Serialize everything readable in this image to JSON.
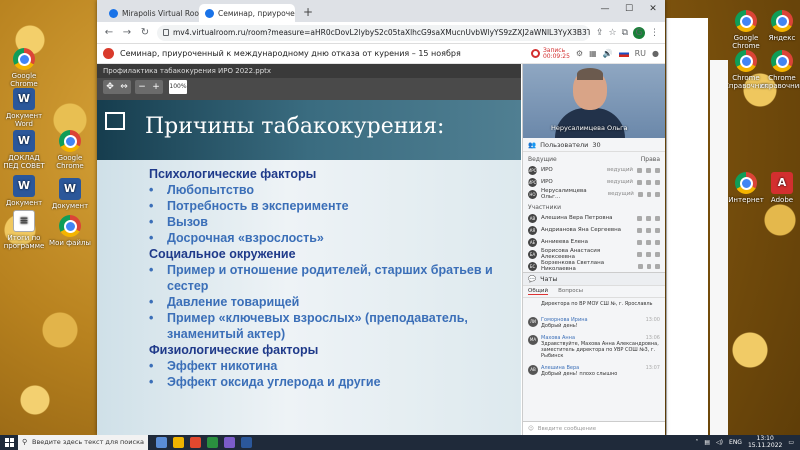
{
  "desktop": {
    "left_icons": [
      {
        "label": "Google Chrome",
        "type": "chrome"
      },
      {
        "label": "Документ Word",
        "type": "word"
      },
      {
        "label": "ДОКЛАД ПЕД СОВЕТ",
        "type": "word"
      },
      {
        "label": "Google Chrome",
        "type": "chrome"
      },
      {
        "label": "Документ",
        "type": "word"
      },
      {
        "label": "Итоги по программе",
        "type": "doc"
      },
      {
        "label": "Документ",
        "type": "word"
      },
      {
        "label": "Мои файлы",
        "type": "chrome"
      }
    ],
    "right_icons": [
      {
        "label": "Google Chrome",
        "type": "chrome"
      },
      {
        "label": "Яндекс",
        "type": "chrome"
      },
      {
        "label": "Chrome Справочник",
        "type": "chrome"
      },
      {
        "label": "Chrome справочник",
        "type": "chrome"
      },
      {
        "label": "Adobe",
        "type": "pdf"
      },
      {
        "label": "Интернет",
        "type": "chrome"
      }
    ]
  },
  "browser": {
    "tabs": [
      {
        "title": "Mirapolis Virtual Room",
        "active": false
      },
      {
        "title": "Семинар, приуроченный к",
        "active": true
      }
    ],
    "new_tab": "+",
    "url": "mv4.virtualroom.ru/room?measure=aHR0cDovL2lybyS2c05taXlhcG9saXMucnUvbWlyYS9zZXJ2aWNlL3YyX3B3TmtRM0hSaUEzb0lCX1RJeGx6VVE&user=guest-b2a6ea74..."
  },
  "app": {
    "title": "Семинар, приуроченный к международному дню отказа от курения – 15 ноября",
    "record_label": "Запись",
    "record_time": "00:09:25",
    "language": "RU"
  },
  "presentation": {
    "file_name": "Профилактика табакокурения ИРО 2022.pptx",
    "zoom": "100%",
    "slide": {
      "title": "Причины табакокурения:",
      "sections": [
        {
          "heading": "Психологические факторы",
          "items": [
            "Любопытство",
            "Потребность в эксперименте",
            "Вызов",
            "Досрочная «взрослость»"
          ]
        },
        {
          "heading": "Социальное окружение",
          "items": [
            "Пример и отношение родителей, старших братьев и сестер",
            "Давление товарищей",
            "Пример «ключевых взрослых» (преподаватель, знаменитый актер)"
          ]
        },
        {
          "heading": "Физиологические факторы",
          "items": [
            "Эффект никотина",
            "Эффект оксида углерода и другие"
          ]
        }
      ]
    }
  },
  "side": {
    "video_name": "Нерусалимцева Ольга",
    "users_label": "Пользователи",
    "users_count": "30",
    "leaders_label": "Ведущие",
    "rights_label": "Права",
    "leaders": [
      {
        "initials": "ИРО",
        "name": "ИРО",
        "role": "ведущий"
      },
      {
        "initials": "ИРО",
        "name": "ИРО",
        "role": "ведущий"
      },
      {
        "initials": "НО",
        "name": "Нерусалимцева Ольг...",
        "role": "ведущий"
      }
    ],
    "participants_label": "Участники",
    "participants": [
      {
        "initials": "АВ",
        "name": "Алешина Вера Петровна"
      },
      {
        "initials": "АЯ",
        "name": "Андрианова Яна Сергеевна"
      },
      {
        "initials": "АЕ",
        "name": "Анниеева Елена"
      },
      {
        "initials": "БА",
        "name": "Борисова Анастасия Алексеевна"
      },
      {
        "initials": "БС",
        "name": "Борзенкова Светлана Николаевна"
      }
    ],
    "chat_label": "Чаты",
    "chat_tabs": [
      "Общий",
      "Вопросы"
    ],
    "messages": [
      {
        "initials": "",
        "who": "",
        "time": "",
        "text": "Директора по ВР МОУ СШ №, г. Ярославль"
      },
      {
        "initials": "ЛИ",
        "who": "Гоморнова Ирина",
        "time": "13:00",
        "text": "Добрый день!"
      },
      {
        "initials": "МА",
        "who": "Махова Анна",
        "time": "13:06",
        "text": "Здравствуйте, Махова Анна Александровна, заместитель директора по УВР СОШ №3, г. Рыбинск"
      },
      {
        "initials": "АВ",
        "who": "Алешина Вера",
        "time": "13:07",
        "text": "Добрый день! плохо слышно"
      }
    ],
    "input_placeholder": "Введите сообщение"
  },
  "taskbar": {
    "search_placeholder": "Введите здесь текст для поиска",
    "lang": "ENG",
    "time": "13:10",
    "date": "15.11.2022"
  }
}
